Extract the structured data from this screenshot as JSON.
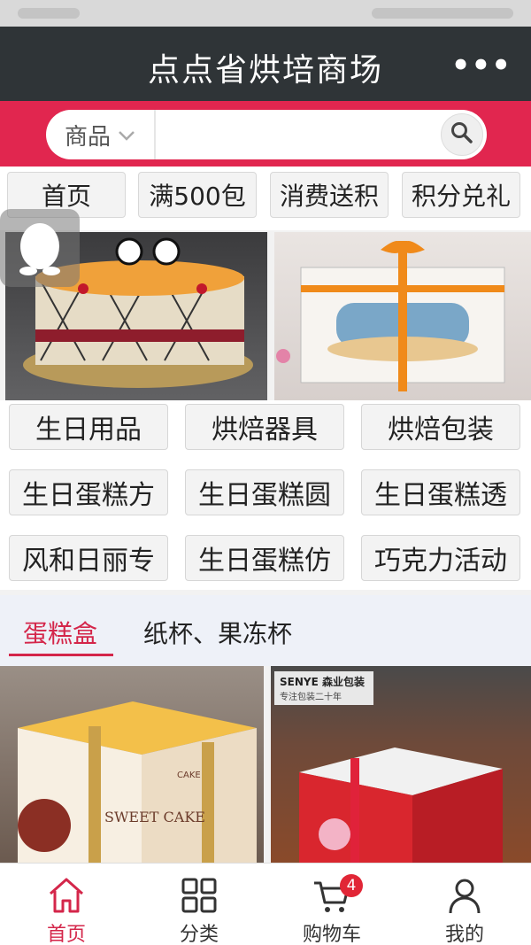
{
  "header": {
    "title": "点点省烘培商场",
    "more_label": "•••"
  },
  "search": {
    "category": "商品",
    "placeholder": "",
    "value": ""
  },
  "quick_nav": [
    {
      "label": "首页"
    },
    {
      "label": "满500包"
    },
    {
      "label": "消费送积"
    },
    {
      "label": "积分兑礼"
    }
  ],
  "categories": [
    {
      "label": "生日用品"
    },
    {
      "label": "烘焙器具"
    },
    {
      "label": "烘焙包装"
    },
    {
      "label": "生日蛋糕方"
    },
    {
      "label": "生日蛋糕圆"
    },
    {
      "label": "生日蛋糕透"
    },
    {
      "label": "风和日丽专"
    },
    {
      "label": "生日蛋糕仿"
    },
    {
      "label": "巧克力活动"
    }
  ],
  "tabs": [
    {
      "label": "蛋糕盒",
      "active": true
    },
    {
      "label": "纸杯、果冻杯",
      "active": false
    }
  ],
  "products": [
    {
      "box_text": "SWEET CAKE",
      "box_brand": "CAKE"
    },
    {
      "sign_text": "SENYE 森业包装",
      "sign_sub": "专注包装二十年"
    }
  ],
  "tabbar": [
    {
      "label": "首页",
      "icon": "home-icon",
      "active": true
    },
    {
      "label": "分类",
      "icon": "grid-icon",
      "active": false
    },
    {
      "label": "购物车",
      "icon": "cart-icon",
      "active": false,
      "badge": "4"
    },
    {
      "label": "我的",
      "icon": "user-icon",
      "active": false
    }
  ],
  "colors": {
    "header_bg": "#2f3437",
    "accent": "#d4264a",
    "search_band": "#e1264f",
    "badge": "#e12636"
  }
}
